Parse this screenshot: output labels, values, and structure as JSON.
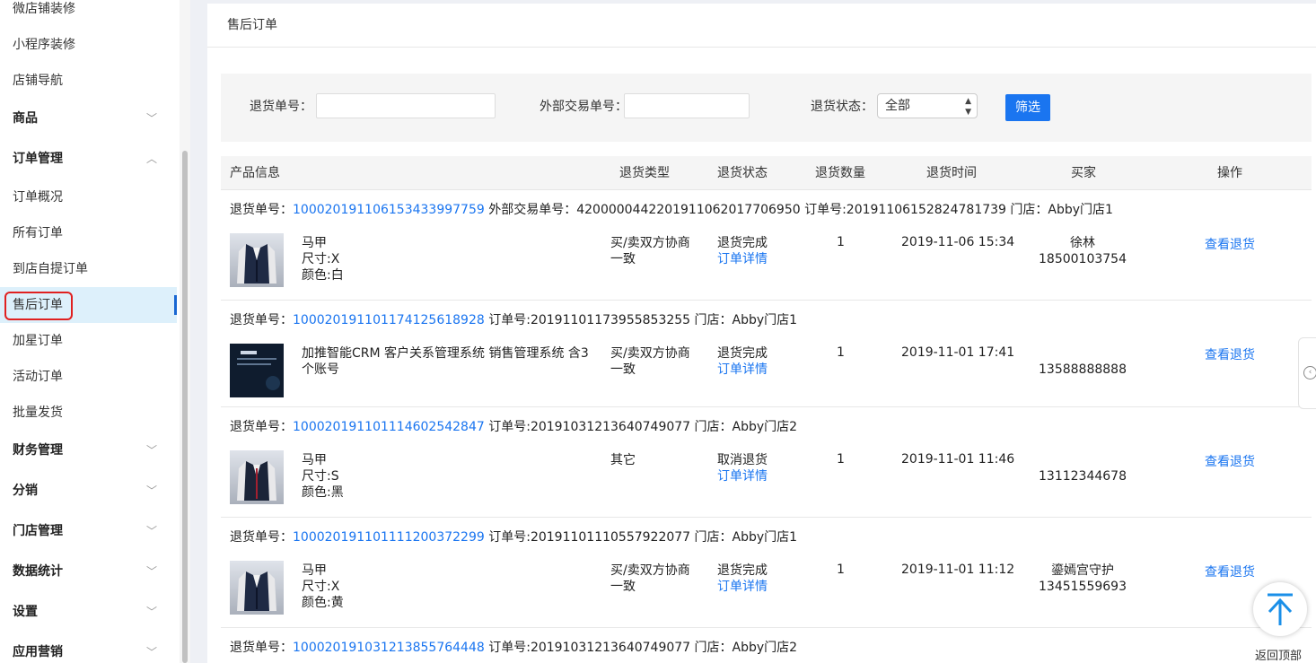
{
  "sidebar": {
    "items": [
      {
        "label": "微店铺装修",
        "group": false
      },
      {
        "label": "小程序装修",
        "group": false
      },
      {
        "label": "店铺导航",
        "group": false
      },
      {
        "label": "商品",
        "group": true,
        "expanded": false
      },
      {
        "label": "订单管理",
        "group": true,
        "expanded": true
      },
      {
        "label": "订单概况",
        "group": false
      },
      {
        "label": "所有订单",
        "group": false
      },
      {
        "label": "到店自提订单",
        "group": false
      },
      {
        "label": "售后订单",
        "group": false,
        "active": true
      },
      {
        "label": "加星订单",
        "group": false
      },
      {
        "label": "活动订单",
        "group": false
      },
      {
        "label": "批量发货",
        "group": false
      },
      {
        "label": "财务管理",
        "group": true,
        "expanded": false
      },
      {
        "label": "分销",
        "group": true,
        "expanded": false
      },
      {
        "label": "门店管理",
        "group": true,
        "expanded": false
      },
      {
        "label": "数据统计",
        "group": true,
        "expanded": false
      },
      {
        "label": "设置",
        "group": true,
        "expanded": false
      },
      {
        "label": "应用营销",
        "group": true,
        "expanded": false
      }
    ]
  },
  "page": {
    "title": "售后订单"
  },
  "filter": {
    "return_no_label": "退货单号：",
    "return_no_value": "",
    "ext_no_label": "外部交易单号：",
    "ext_no_value": "",
    "status_label": "退货状态：",
    "status_value": "全部",
    "submit_label": "筛选"
  },
  "table": {
    "headers": [
      "产品信息",
      "退货类型",
      "退货状态",
      "退货数量",
      "退货时间",
      "买家",
      "操作"
    ]
  },
  "orders": [
    {
      "return_label": "退货单号：",
      "return_no": "100020191106153433997759",
      "rest": " 外部交易单号：4200000442201911062017706950 订单号:20191106152824781739 门店：Abby门店1",
      "product_lines": [
        "马甲",
        "尺寸:X",
        "颜色:白"
      ],
      "type": "买/卖双方协商一致",
      "status": "退货完成",
      "status_link": "订单详情",
      "qty": "1",
      "time": "2019-11-06 15:34",
      "buyer_name": "徐林",
      "buyer_phone": "18500103754",
      "op": "查看退货",
      "thumb": "vest"
    },
    {
      "return_label": "退货单号：",
      "return_no": "100020191101174125618928",
      "rest": " 订单号:20191101173955853255 门店：Abby门店1",
      "product_lines": [
        "加推智能CRM 客户关系管理系统 销售管理系统 含3",
        "个账号"
      ],
      "type": "买/卖双方协商一致",
      "status": "退货完成",
      "status_link": "订单详情",
      "qty": "1",
      "time": "2019-11-01 17:41",
      "buyer_name": "",
      "buyer_phone": "13588888888",
      "op": "查看退货",
      "thumb": "crm"
    },
    {
      "return_label": "退货单号：",
      "return_no": "100020191101114602542847",
      "rest": " 订单号:20191031213640749077 门店：Abby门店2",
      "product_lines": [
        "马甲",
        "尺寸:S",
        "颜色:黑"
      ],
      "type": "其它",
      "status": "取消退货",
      "status_link": "订单详情",
      "qty": "1",
      "time": "2019-11-01 11:46",
      "buyer_name": "",
      "buyer_phone": "13112344678",
      "op": "查看退货",
      "thumb": "vest"
    },
    {
      "return_label": "退货单号：",
      "return_no": "100020191101111200372299",
      "rest": " 订单号:20191101110557922077 门店：Abby门店1",
      "product_lines": [
        "马甲",
        "尺寸:X",
        "颜色:黄"
      ],
      "type": "买/卖双方协商一致",
      "status": "退货完成",
      "status_link": "订单详情",
      "qty": "1",
      "time": "2019-11-01 11:12",
      "buyer_name": "鎏嫣宫守护",
      "buyer_phone": "13451559693",
      "op": "查看退货",
      "thumb": "vest"
    },
    {
      "return_label": "退货单号：",
      "return_no": "100020191031213855764448",
      "rest": " 订单号:20191031213640749077 门店：Abby门店2"
    }
  ],
  "float": {
    "backtop_label": "返回顶部"
  }
}
